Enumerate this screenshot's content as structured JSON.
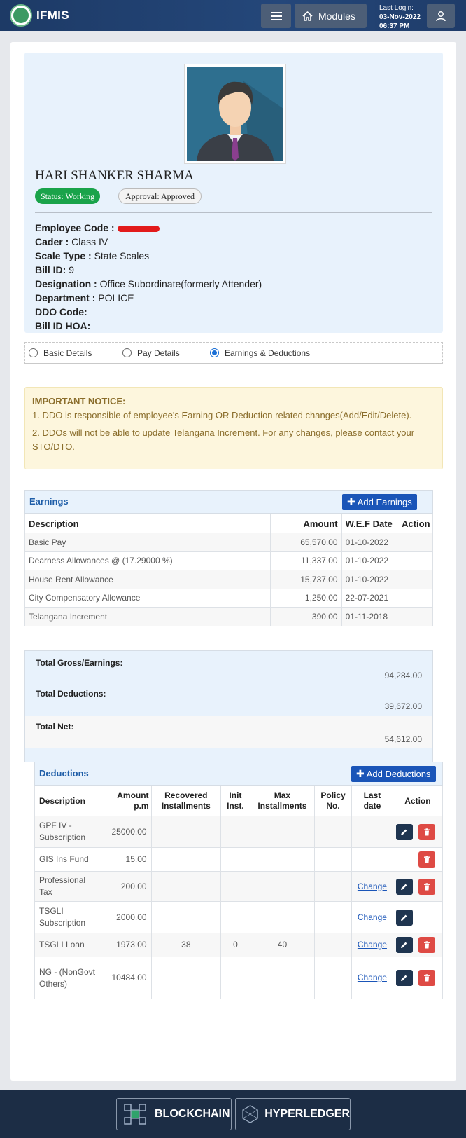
{
  "header": {
    "app_title": "IFMIS",
    "modules_label": "Modules",
    "last_login_label": "Last Login:",
    "last_login_date": "03-Nov-2022",
    "last_login_time": "06:37 PM"
  },
  "profile": {
    "name": "HARI SHANKER SHARMA",
    "status_badge": "Status: Working",
    "approval_badge": "Approval: Approved",
    "fields": {
      "employee_code_label": "Employee Code :",
      "cader_label": "Cader :",
      "cader_value": "Class IV",
      "scale_type_label": "Scale Type :",
      "scale_type_value": "State Scales",
      "bill_id_label": "Bill ID:",
      "bill_id_value": "9",
      "designation_label": "Designation :",
      "designation_value": "Office Subordinate(formerly Attender)",
      "department_label": "Department :",
      "department_value": "POLICE",
      "ddo_code_label": "DDO Code:",
      "bill_id_hoa_label": "Bill ID HOA:"
    }
  },
  "tabs": {
    "basic": "Basic Details",
    "pay": "Pay Details",
    "earnings": "Earnings & Deductions",
    "selected": "earnings"
  },
  "notice": {
    "title": "IMPORTANT NOTICE:",
    "line1": "1. DDO is responsible of employee's Earning OR Deduction related changes(Add/Edit/Delete).",
    "line2": "2. DDOs will not be able to update Telangana Increment. For any changes, please contact your STO/DTO."
  },
  "earnings": {
    "title": "Earnings",
    "add_label": "Add Earnings",
    "headers": [
      "Description",
      "Amount",
      "W.E.F Date",
      "Action"
    ],
    "rows": [
      [
        "Basic Pay",
        "65,570.00",
        "01-10-2022"
      ],
      [
        "Dearness Allowances @ (17.29000 %)",
        "11,337.00",
        "01-10-2022"
      ],
      [
        "House Rent Allowance",
        "15,737.00",
        "01-10-2022"
      ],
      [
        "City Compensatory Allowance",
        "1,250.00",
        "22-07-2021"
      ],
      [
        "Telangana Increment",
        "390.00",
        "01-11-2018"
      ]
    ]
  },
  "totals": {
    "gross_label": "Total Gross/Earnings:",
    "gross_value": "94,284.00",
    "deductions_label": "Total Deductions:",
    "deductions_value": "39,672.00",
    "net_label": "Total Net:",
    "net_value": "54,612.00"
  },
  "deductions": {
    "title": "Deductions",
    "add_label": "Add Deductions",
    "headers": [
      "Description",
      "Amount p.m",
      "Recovered Installments",
      "Init Inst.",
      "Max Installments",
      "Policy No.",
      "Last date",
      "Action"
    ],
    "change_label": "Change",
    "rows": [
      {
        "desc": "GPF IV - Subscription",
        "amount": "25000.00",
        "recovered": "",
        "init": "",
        "max": "",
        "policy": "",
        "change": false,
        "edit": true,
        "del": true
      },
      {
        "desc": "GIS Ins Fund",
        "amount": "15.00",
        "recovered": "",
        "init": "",
        "max": "",
        "policy": "",
        "change": false,
        "edit": false,
        "del": true
      },
      {
        "desc": "Professional Tax",
        "amount": "200.00",
        "recovered": "",
        "init": "",
        "max": "",
        "policy": "",
        "change": true,
        "edit": true,
        "del": true
      },
      {
        "desc": "TSGLI Subscription",
        "amount": "2000.00",
        "recovered": "",
        "init": "",
        "max": "",
        "policy": "",
        "change": true,
        "edit": true,
        "del": false
      },
      {
        "desc": "TSGLI Loan",
        "amount": "1973.00",
        "recovered": "38",
        "init": "0",
        "max": "40",
        "policy": "",
        "change": true,
        "edit": true,
        "del": true
      },
      {
        "desc": "NG - (NonGovt Others)",
        "amount": "10484.00",
        "recovered": "",
        "init": "",
        "max": "",
        "policy": "",
        "change": true,
        "edit": true,
        "del": true
      }
    ]
  },
  "footer": {
    "blockchain_label": "BLOCKCHAIN",
    "hyperledger_label": "HYPERLEDGER"
  },
  "colors": {
    "header_bg": "#1d3a66",
    "accent_blue": "#1a55b8",
    "status_green": "#1aa34a",
    "delete_red": "#de4a44",
    "profile_bg": "#e8f2fc",
    "notice_bg": "#fdf6dd"
  }
}
